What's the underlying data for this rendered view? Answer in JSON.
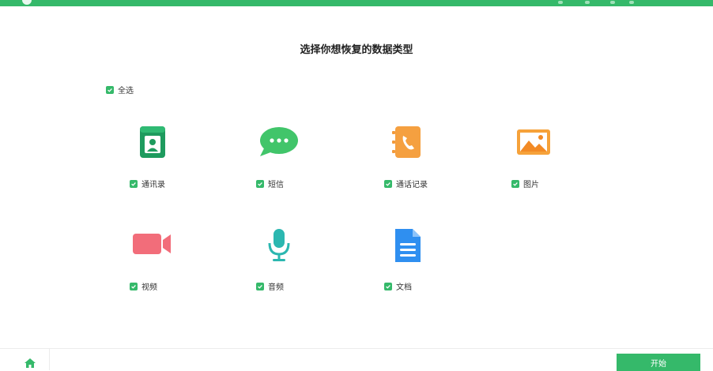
{
  "header": {
    "title": "选择你想恢复的数据类型"
  },
  "select_all": {
    "label": "全选",
    "checked": true
  },
  "types": [
    {
      "label": "通讯录",
      "icon": "contacts-icon",
      "checked": true
    },
    {
      "label": "短信",
      "icon": "message-icon",
      "checked": true
    },
    {
      "label": "通话记录",
      "icon": "call-log-icon",
      "checked": true
    },
    {
      "label": "图片",
      "icon": "image-icon",
      "checked": true
    },
    {
      "label": "视频",
      "icon": "video-icon",
      "checked": true
    },
    {
      "label": "音频",
      "icon": "microphone-icon",
      "checked": true
    },
    {
      "label": "文档",
      "icon": "document-icon",
      "checked": true
    }
  ],
  "footer": {
    "start_label": "开始",
    "home_icon": "home-icon"
  },
  "colors": {
    "accent": "#35b96a"
  }
}
